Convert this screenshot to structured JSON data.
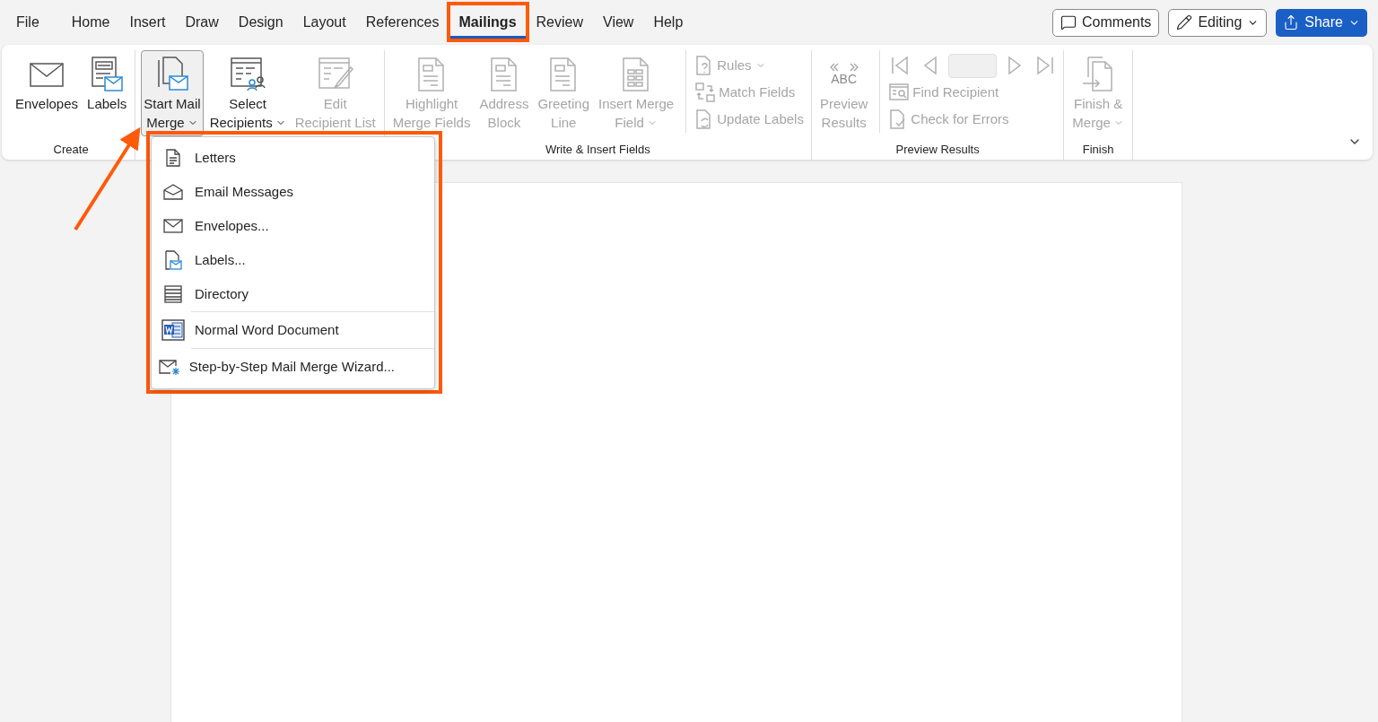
{
  "menu_tabs": [
    {
      "label": "File",
      "selected": false
    },
    {
      "label": "Home",
      "selected": false
    },
    {
      "label": "Insert",
      "selected": false
    },
    {
      "label": "Draw",
      "selected": false
    },
    {
      "label": "Design",
      "selected": false
    },
    {
      "label": "Layout",
      "selected": false
    },
    {
      "label": "References",
      "selected": false
    },
    {
      "label": "Mailings",
      "selected": true
    },
    {
      "label": "Review",
      "selected": false
    },
    {
      "label": "View",
      "selected": false
    },
    {
      "label": "Help",
      "selected": false
    }
  ],
  "top_buttons": [
    {
      "label": "Comments",
      "kind": "comments"
    },
    {
      "label": "Editing",
      "kind": "editing"
    },
    {
      "label": "Share",
      "kind": "share"
    }
  ],
  "ribbon": {
    "groups": [
      {
        "label": "Create",
        "commands": [
          {
            "kind": "large",
            "lines": [
              "Envelopes"
            ],
            "disabled": false,
            "dropdown": false,
            "pressed": false
          },
          {
            "kind": "large",
            "lines": [
              "Labels"
            ],
            "disabled": false,
            "dropdown": false,
            "pressed": false
          }
        ]
      },
      {
        "commands": [
          {
            "kind": "large",
            "lines": [
              "Start Mail",
              "Merge"
            ],
            "disabled": false,
            "dropdown": true,
            "pressed": true
          },
          {
            "kind": "large",
            "lines": [
              "Select",
              "Recipients"
            ],
            "disabled": false,
            "dropdown": true,
            "pressed": false
          },
          {
            "kind": "large",
            "lines": [
              "Edit",
              "Recipient List"
            ],
            "disabled": true,
            "dropdown": false,
            "pressed": false
          }
        ]
      },
      {
        "label": "Write & Insert Fields",
        "commands": [
          {
            "kind": "large",
            "lines": [
              "Highlight",
              "Merge Fields"
            ],
            "disabled": true,
            "dropdown": false,
            "pressed": false
          },
          {
            "kind": "large",
            "lines": [
              "Address",
              "Block"
            ],
            "disabled": true,
            "dropdown": false,
            "pressed": false
          },
          {
            "kind": "large",
            "lines": [
              "Greeting",
              "Line"
            ],
            "disabled": true,
            "dropdown": false,
            "pressed": false
          },
          {
            "kind": "large",
            "lines": [
              "Insert Merge",
              "Field"
            ],
            "disabled": true,
            "dropdown": true,
            "pressed": false
          },
          {
            "kind": "small",
            "lines": [
              "Rules"
            ],
            "disabled": true,
            "dropdown": true
          },
          {
            "kind": "small",
            "lines": [
              "Match Fields"
            ],
            "disabled": true,
            "dropdown": false
          },
          {
            "kind": "small",
            "lines": [
              "Update Labels"
            ],
            "disabled": true,
            "dropdown": false
          }
        ]
      },
      {
        "label": "Preview Results",
        "commands": [
          {
            "kind": "large",
            "icon_text": "ABC",
            "lines": [
              "Preview",
              "Results"
            ],
            "disabled": true,
            "dropdown": false,
            "pressed": false
          },
          {
            "kind": "nav",
            "disabled": true
          },
          {
            "kind": "small",
            "lines": [
              "Find Recipient"
            ],
            "disabled": true,
            "dropdown": false
          },
          {
            "kind": "small",
            "lines": [
              "Check for Errors"
            ],
            "disabled": true,
            "dropdown": false
          }
        ]
      },
      {
        "label": "Finish",
        "commands": [
          {
            "kind": "large",
            "lines": [
              "Finish &",
              "Merge"
            ],
            "disabled": true,
            "dropdown": true,
            "pressed": false
          }
        ]
      }
    ]
  },
  "dropdown": {
    "sections": [
      {
        "items": [
          {
            "label": "Letters"
          },
          {
            "label": "Email Messages"
          },
          {
            "label": "Envelopes..."
          },
          {
            "label": "Labels..."
          },
          {
            "label": "Directory"
          }
        ]
      },
      {
        "items": [
          {
            "label": "Normal Word Document"
          }
        ]
      },
      {
        "items": [
          {
            "label": "Step-by-Step Mail Merge Wizard..."
          }
        ]
      }
    ]
  }
}
